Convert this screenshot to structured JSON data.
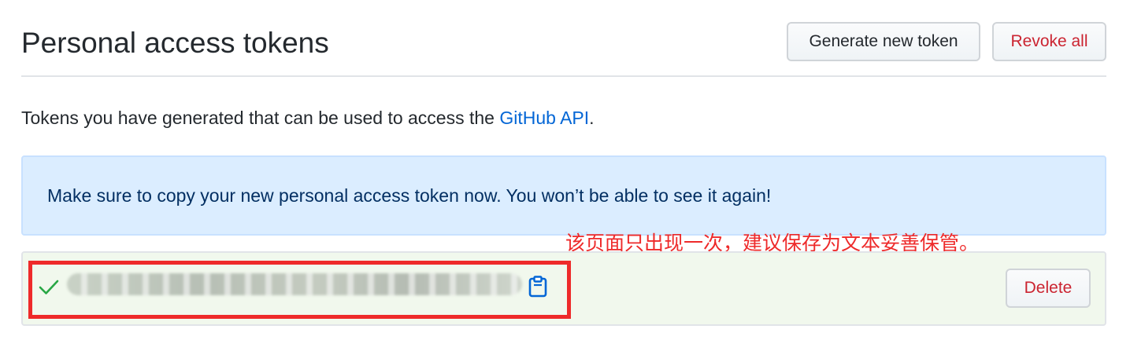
{
  "header": {
    "title": "Personal access tokens",
    "generate_button": "Generate new token",
    "revoke_button": "Revoke all"
  },
  "description": {
    "text_before": "Tokens you have generated that can be used to access the ",
    "link_text": "GitHub API",
    "text_after": "."
  },
  "flash": {
    "message": "Make sure to copy your new personal access token now. You won’t be able to see it again!"
  },
  "annotation": {
    "text": "该页面只出现一次，建议保存为文本妥善保管。"
  },
  "token": {
    "status_icon": "check-icon",
    "copy_icon": "clipboard-icon",
    "delete_button": "Delete"
  },
  "colors": {
    "link": "#0366d6",
    "danger": "#cb2431",
    "flash_bg": "#dbedff",
    "token_bg": "#f1f8ed",
    "annotation": "#ee2a2a",
    "success": "#28a745"
  }
}
